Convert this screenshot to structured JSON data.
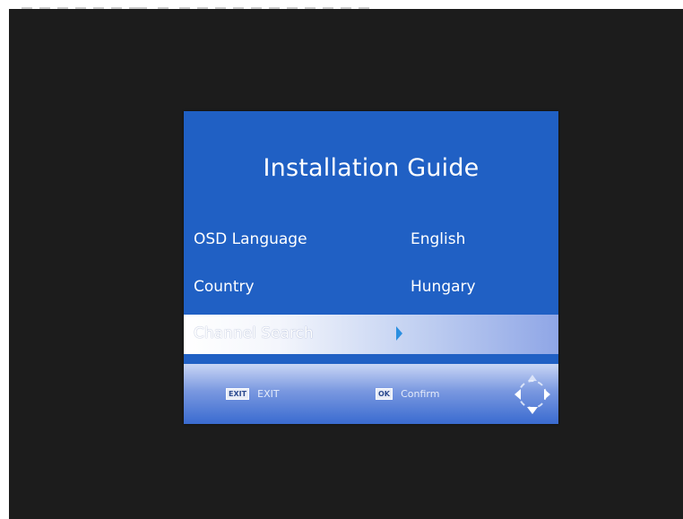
{
  "dialog": {
    "title": "Installation Guide",
    "rows": [
      {
        "label": "OSD Language",
        "value": "English"
      },
      {
        "label": "Country",
        "value": "Hungary"
      },
      {
        "label": "Channel Search"
      }
    ],
    "selected_row": "Channel Search"
  },
  "footer": {
    "exit_key": "EXIT",
    "exit_label": "EXIT",
    "ok_key": "OK",
    "confirm_label": "Confirm"
  },
  "icons": {
    "nav": "directional-pad-icon",
    "search_arrow": "right-arrow-icon"
  },
  "colors": {
    "screen_background": "#1c1c1c",
    "dialog_background": "#2060c4",
    "selection_highlight": "#ffffff",
    "arrow": "#2a8fe0"
  }
}
